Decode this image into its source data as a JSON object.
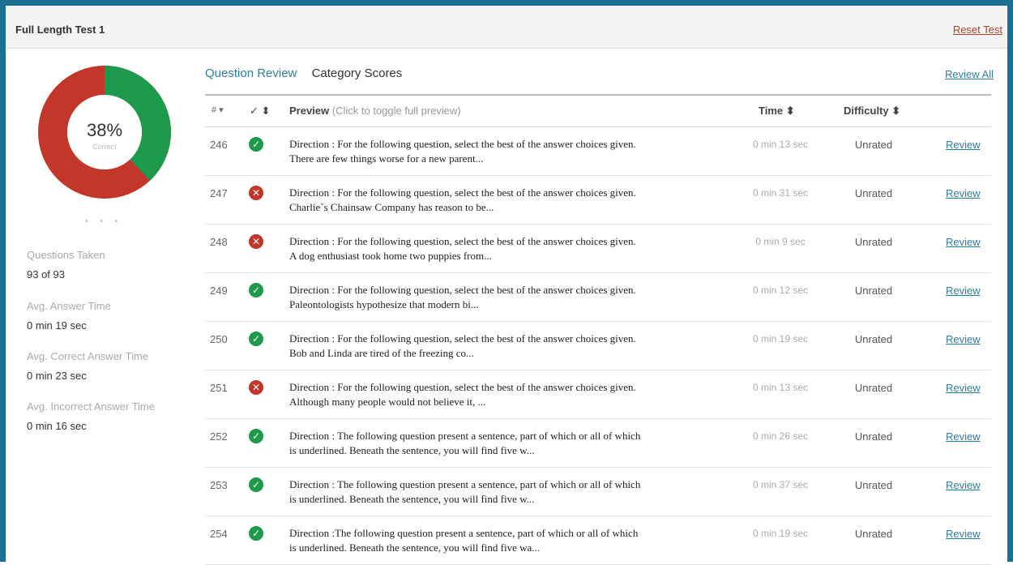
{
  "header": {
    "title": "Full Length Test 1",
    "reset_label": "Reset Test"
  },
  "summary": {
    "percent_text": "38%",
    "percent_caption": "Correct",
    "correct_fraction": 0.38,
    "colors": {
      "correct": "#1e9a4c",
      "incorrect": "#c2372a"
    },
    "pager_dots": "• • •",
    "stats": [
      {
        "label": "Questions Taken",
        "value": "93 of 93"
      },
      {
        "label": "Avg. Answer Time",
        "value": "0 min 19 sec"
      },
      {
        "label": "Avg. Correct Answer Time",
        "value": "0 min 23 sec"
      },
      {
        "label": "Avg. Incorrect Answer Time",
        "value": "0 min 16 sec"
      }
    ]
  },
  "tabs": {
    "question_review": "Question Review",
    "category_scores": "Category Scores"
  },
  "review_all_label": "Review All",
  "table": {
    "headers": {
      "num": "# ▾",
      "check": "✓ ⬍",
      "preview": "Preview",
      "preview_hint": "(Click to toggle full preview)",
      "time": "Time ⬍",
      "difficulty": "Difficulty ⬍"
    },
    "rows": [
      {
        "num": "246",
        "correct": true,
        "preview_line1": "Direction : For the following question, select the best of the answer choices given.",
        "preview_line2": "There are few things worse for a new parent...",
        "time": "0 min 13 sec",
        "difficulty": "Unrated",
        "review": "Review"
      },
      {
        "num": "247",
        "correct": false,
        "preview_line1": "Direction : For the following question, select the best of the answer choices given.",
        "preview_line2": "Charlie`s Chainsaw Company has reason to be...",
        "time": "0 min 31 sec",
        "difficulty": "Unrated",
        "review": "Review"
      },
      {
        "num": "248",
        "correct": false,
        "preview_line1": "Direction : For the following question, select the best of the answer choices given.",
        "preview_line2": "A dog enthusiast took home two puppies from...",
        "time": "0 min 9 sec",
        "difficulty": "Unrated",
        "review": "Review"
      },
      {
        "num": "249",
        "correct": true,
        "preview_line1": "Direction : For the following question, select the best of the answer choices given.",
        "preview_line2": "Paleontologists hypothesize that modern bi...",
        "time": "0 min 12 sec",
        "difficulty": "Unrated",
        "review": "Review"
      },
      {
        "num": "250",
        "correct": true,
        "preview_line1": "Direction : For the following question, select the best of the answer choices given.",
        "preview_line2": "Bob and Linda are tired of the freezing co...",
        "time": "0 min 19 sec",
        "difficulty": "Unrated",
        "review": "Review"
      },
      {
        "num": "251",
        "correct": false,
        "preview_line1": "Direction : For the following question, select the best of the answer choices given.",
        "preview_line2": "Although many people would not believe it, ...",
        "time": "0 min 13 sec",
        "difficulty": "Unrated",
        "review": "Review"
      },
      {
        "num": "252",
        "correct": true,
        "preview_line1": "Direction : The following question present a sentence, part of which or all of which",
        "preview_line2": "is underlined. Beneath the sentence, you will find five w...",
        "time": "0 min 26 sec",
        "difficulty": "Unrated",
        "review": "Review"
      },
      {
        "num": "253",
        "correct": true,
        "preview_line1": "Direction : The following question present a sentence, part of which or all of which",
        "preview_line2": "is underlined. Beneath the sentence, you will find five w...",
        "time": "0 min 37 sec",
        "difficulty": "Unrated",
        "review": "Review"
      },
      {
        "num": "254",
        "correct": true,
        "preview_line1": "Direction :The following question present a sentence, part of which or all of which",
        "preview_line2": "is underlined. Beneath the sentence, you will find five wa...",
        "time": "0 min 19 sec",
        "difficulty": "Unrated",
        "review": "Review"
      }
    ]
  }
}
